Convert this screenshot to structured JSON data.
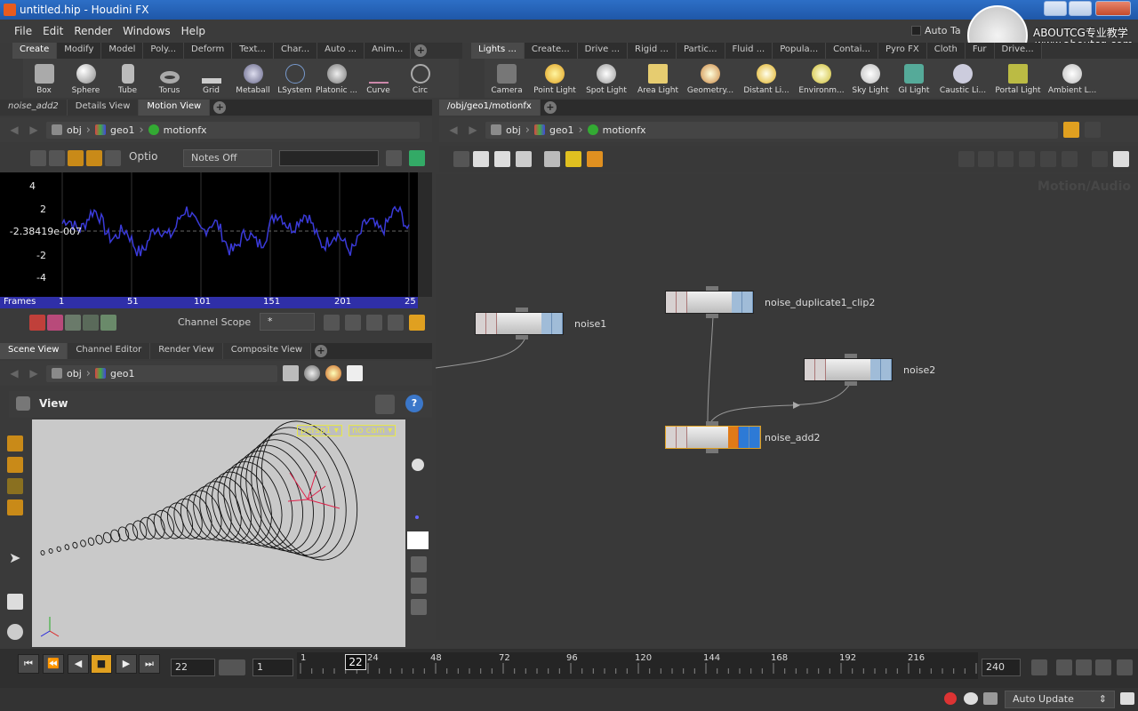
{
  "window": {
    "title": "untitled.hip - Houdini FX"
  },
  "menu": [
    "File",
    "Edit",
    "Render",
    "Windows",
    "Help"
  ],
  "auto_take": "Auto Ta",
  "watermark": {
    "brand": "ABOUTCG专业教学",
    "url": "www.aboutcg.com"
  },
  "shelf_left": {
    "tabs": [
      "Create",
      "Modify",
      "Model",
      "Poly...",
      "Deform",
      "Text...",
      "Char...",
      "Auto ...",
      "Anim..."
    ],
    "tools": [
      "Box",
      "Sphere",
      "Tube",
      "Torus",
      "Grid",
      "Metaball",
      "LSystem",
      "Platonic ...",
      "Curve",
      "Circ"
    ]
  },
  "shelf_right": {
    "tabs": [
      "Lights ...",
      "Create...",
      "Drive ...",
      "Rigid ...",
      "Partic...",
      "Fluid ...",
      "Popula...",
      "Contai...",
      "Pyro FX",
      "Cloth",
      "Fur",
      "Drive..."
    ],
    "tools": [
      "Camera",
      "Point Light",
      "Spot Light",
      "Area Light",
      "Geometry...",
      "Distant Li...",
      "Environm...",
      "Sky Light",
      "GI Light",
      "Caustic Li...",
      "Portal Light",
      "Ambient L..."
    ]
  },
  "motion_pane": {
    "tabs": [
      "noise_add2",
      "Details View",
      "Motion View"
    ],
    "path": [
      "obj",
      "geo1",
      "motionfx"
    ],
    "options_label": "Optio",
    "notes_label": "Notes Off",
    "y_ticks": [
      "4",
      "2",
      "-2.38419e-007",
      "-2",
      "-4"
    ],
    "frames_label": "Frames",
    "x_ticks": [
      "1",
      "51",
      "101",
      "151",
      "201",
      "25"
    ],
    "channel_scope_label": "Channel Scope",
    "channel_scope_value": "*"
  },
  "scene_pane": {
    "tabs": [
      "Scene View",
      "Channel Editor",
      "Render View",
      "Composite View"
    ],
    "path": [
      "obj",
      "geo1"
    ],
    "view_label": "View",
    "persp_label": "persp1",
    "cam_label": "no cam"
  },
  "network_pane": {
    "tab": "/obj/geo1/motionfx",
    "path": [
      "obj",
      "geo1",
      "motionfx"
    ],
    "context_watermark": "Motion/Audio",
    "nodes": [
      "noise1",
      "noise_duplicate1_clip2",
      "noise2",
      "noise_add2"
    ]
  },
  "timeline": {
    "current_frame": "22",
    "start_frame": "1",
    "end_frame": "240",
    "cursor_label": "22",
    "ticks": [
      "1",
      "24",
      "48",
      "72",
      "96",
      "120",
      "144",
      "168",
      "192",
      "216"
    ]
  },
  "status": {
    "update_mode": "Auto Update"
  },
  "colors": {
    "accent": "#e0a020",
    "title_blue": "#2360b8",
    "graph_line": "#3a3ad8",
    "frame_bar": "#2f2fa8"
  }
}
